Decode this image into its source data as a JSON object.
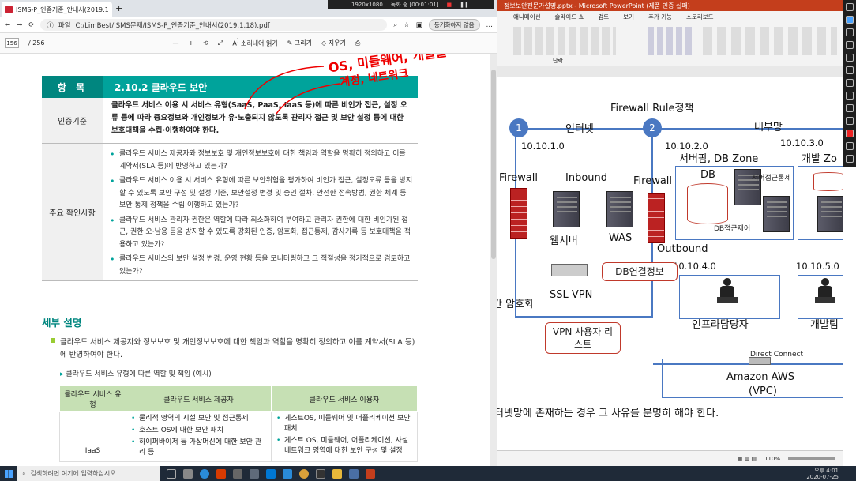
{
  "pdf": {
    "tab_title": "ISMS-P_인증기준_안내서(2019.1",
    "address_prefix": "파일",
    "address": "C:/LimBest/ISMS문제/ISMS-P_인증기준_안내서(2019.1.18).pdf",
    "sync_label": "동기화하지 않음",
    "page_current": "156",
    "page_total": "/ 256",
    "read_aloud": "소리내어 읽기",
    "draw": "그리기",
    "erase": "지우기",
    "header_left": "항 목",
    "header_right": "2.10.2 클라우드 보안",
    "criteria_label": "인증기준",
    "criteria_text": "클라우드 서비스 이용 시 서비스 유형(SaaS, PaaS, IaaS 등)에 따른 비인가 접근, 설정 오류 등에 따라 중요정보와 개인정보가 유·노출되지 않도록 관리자 접근 및 보안 설정 등에 대한 보호대책을 수립·이행하여야 한다.",
    "check_label": "주요 확인사항",
    "checks": [
      "클라우드 서비스 제공자와 정보보호 및 개인정보보호에 대한 책임과 역할을 명확히 정의하고 이를 계약서(SLA 등)에 반영하고 있는가?",
      "클라우드 서비스 이용 시 서비스 유형에 따른 보안위험을 평가하여 비인가 접근, 설정오류 등을 방지할 수 있도록 보안 구성 및 설정 기준, 보안설정 변경 및 승인 절차, 안전한 접속방법, 권한 체계 등 보안 통제 정책을 수립·이행하고 있는가?",
      "클라우드 서비스 관리자 권한은 역할에 따라 최소화하여 부여하고 관리자 권한에 대한 비인가된 접근, 권한 오·남용 등을 방지할 수 있도록 강화된 인증, 암호화, 접근통제, 감사기록 등 보호대책을 적용하고 있는가?",
      "클라우드 서비스의 보안 설정 변경, 운영 현황 등을 모니터링하고 그 적절성을 정기적으로 검토하고 있는가?"
    ],
    "detail_title": "세부 설명",
    "detail_para": "클라우드 서비스 제공자와 정보보호 및 개인정보보호에 대한 책임과 역할을 명확히 정의하고 이를 계약서(SLA 등)에 반영하여야 한다.",
    "detail_sub": "클라우드 서비스 유형에 따른 역할 및 책임 (예시)",
    "table_h1": "클라우드 서비스 유형",
    "table_h2": "클라우드 서비스 제공자",
    "table_h3": "클라우드 서비스 이용자",
    "row1_type": "IaaS",
    "row1_provider": [
      "물리적 영역의 시설 보안 및 접근통제",
      "호스트 OS에 대한 보안 패치",
      "하이퍼바이저 등 가상머신에 대한 보안 관리 등"
    ],
    "row1_user": [
      "게스트OS, 미들웨어 및 어플리케이션 보안 패치",
      "게스트 OS, 미들웨어, 어플리케이션, 사설 네트워크 영역에 대한 보안 구성 및 설정"
    ],
    "annotation1": "OS, 미들웨어, 개발툴",
    "annotation2": "계정, 네트워크"
  },
  "recorder": {
    "resolution": "1920x1080",
    "status": "녹화 중 [00:01:01]"
  },
  "ppt": {
    "title": "정보보안전문가설명.pptx - Microsoft PowerPoint (제품 인증 실패)",
    "menu": [
      "검토",
      "인",
      "디자인",
      "애니메이션",
      "슬라이드 쇼",
      "검토",
      "보기",
      "추가 기능",
      "스토리보드"
    ],
    "ribbon_group": "단락",
    "slide_title": "Firewall Rule정책",
    "internet": "인터넷",
    "internal": "내부망",
    "ip_internet": "10.10.1.0",
    "ip_server": "10.10.2.0",
    "ip_dev": "10.10.3.0",
    "ip_infra": "10.10.4.0",
    "ip_devteam": "10.10.5.0",
    "circle1": "1",
    "circle2": "2",
    "fw1": "Firewall",
    "fw2": "Firewall",
    "inbound": "Inbound",
    "outbound": "Outbound",
    "web": "웹서버",
    "was": "WAS",
    "server_zone": "서버팜, DB Zone",
    "dev_zone": "개발 Zo",
    "db": "DB",
    "server_access": "서버접근통제",
    "db_access": "DB접근제어",
    "db_conn": "DB연결정보",
    "ssl": "SSL VPN",
    "encrypt": "간 암호화",
    "vpn_list": "VPN 사용자 리스트",
    "infra_person": "인프라담당자",
    "dev_team": "개발팀",
    "direct_connect": "Direct Connect",
    "aws": "Amazon AWS",
    "vpc": "(VPC)",
    "bottom_text": "터넷망에 존재하는 경우 그 사유를 분명히 해야 한다.",
    "zoom": "110%"
  },
  "taskbar": {
    "search_placeholder": "검색하려면 여기에 입력하십시오.",
    "time": "오후 4:01",
    "date": "2020-07-25"
  }
}
